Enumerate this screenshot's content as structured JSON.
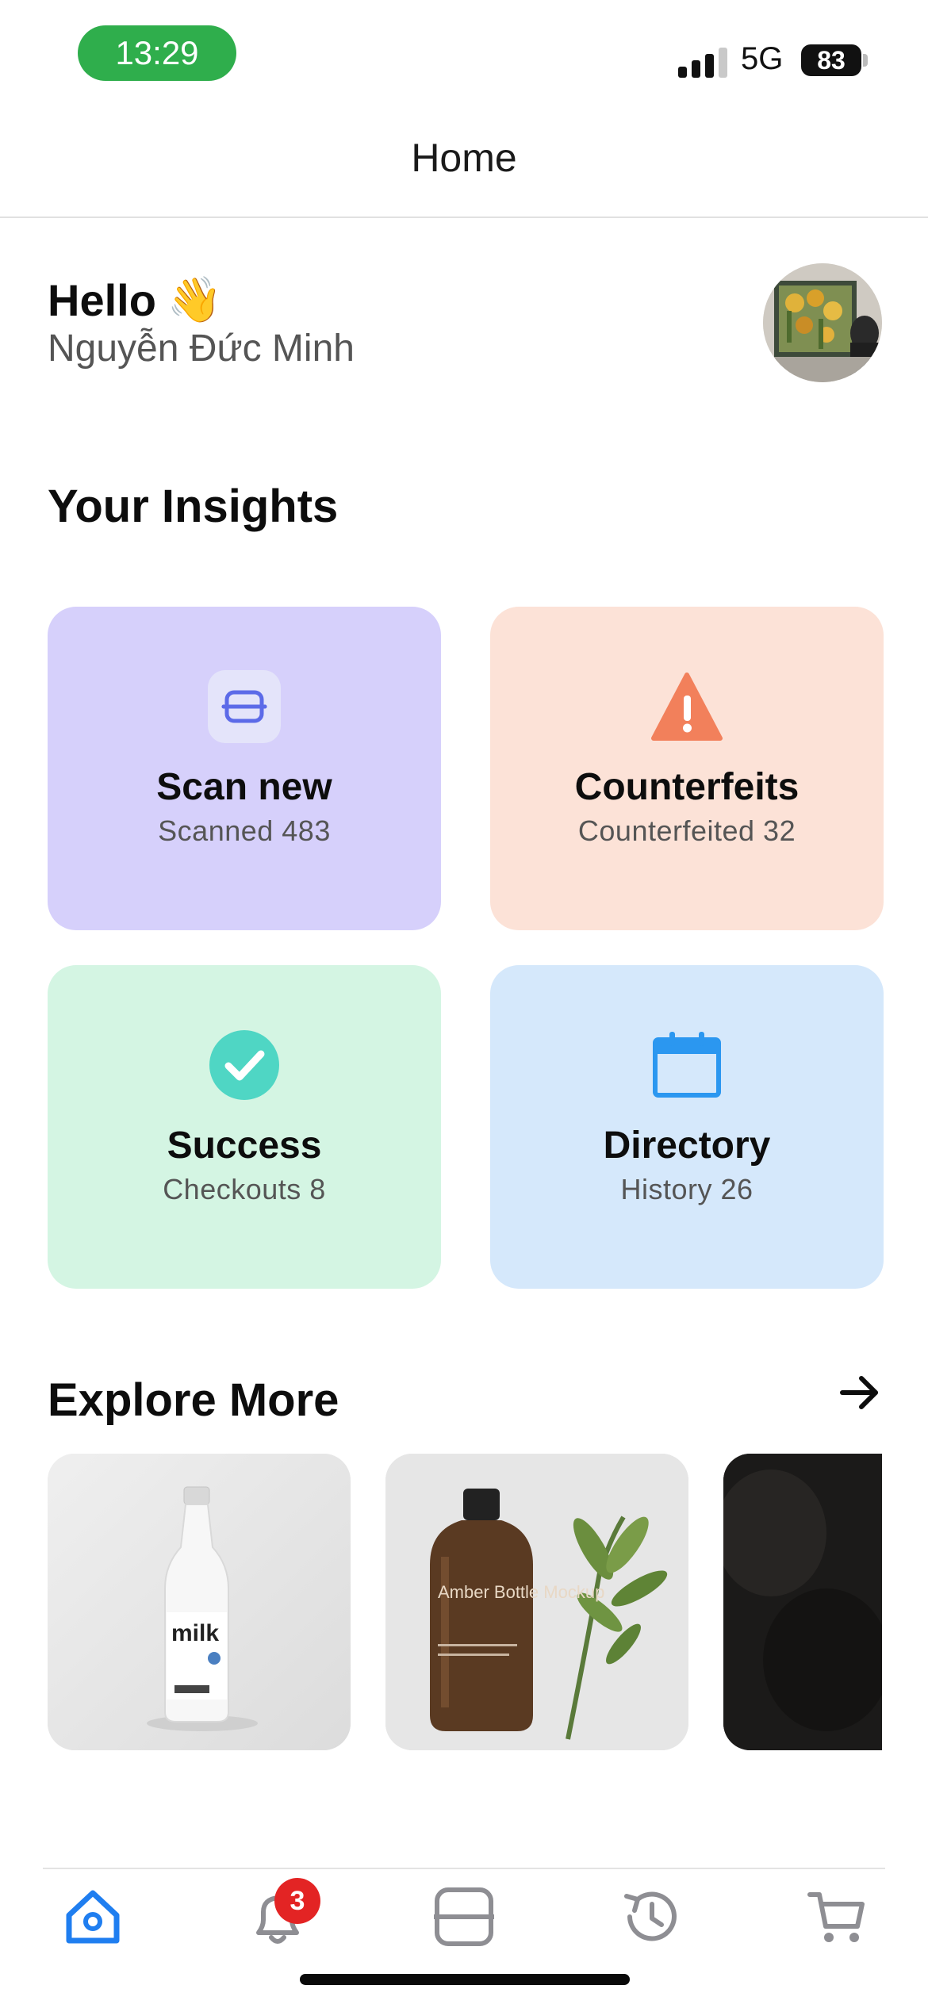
{
  "status_bar": {
    "time": "13:29",
    "network": "5G",
    "battery": "83"
  },
  "nav": {
    "title": "Home"
  },
  "greeting": {
    "hello": "Hello",
    "emoji": "👋",
    "name": "Nguyễn Đức Minh"
  },
  "insights": {
    "title": "Your Insights",
    "cards": [
      {
        "title": "Scan new",
        "subtitle": "Scanned 483",
        "icon": "scan-icon",
        "bg": "#d6d0fb",
        "accent": "#5c6ae8"
      },
      {
        "title": "Counterfeits",
        "subtitle": "Counterfeited 32",
        "icon": "warning-icon",
        "bg": "#fce2d7",
        "accent": "#f2805b"
      },
      {
        "title": "Success",
        "subtitle": "Checkouts 8",
        "icon": "check-circle-icon",
        "bg": "#d4f5e3",
        "accent": "#4fd6c4"
      },
      {
        "title": "Directory",
        "subtitle": "History 26",
        "icon": "calendar-icon",
        "bg": "#d5e8fb",
        "accent": "#2b97f0"
      }
    ]
  },
  "explore": {
    "title": "Explore More",
    "items": [
      {
        "name": "milk-bottle-image",
        "bottle_label": "milk"
      },
      {
        "name": "amber-bottle-image",
        "bottle_label": "Amber Bottle Mockup"
      },
      {
        "name": "dark-product-image"
      }
    ]
  },
  "tabbar": {
    "items": [
      "home-icon",
      "bell-icon",
      "scan-icon",
      "history-icon",
      "cart-icon"
    ],
    "active": "home-icon",
    "notifications_badge": "3",
    "active_color": "#1f7ef0",
    "inactive_color": "#8e8e93"
  }
}
